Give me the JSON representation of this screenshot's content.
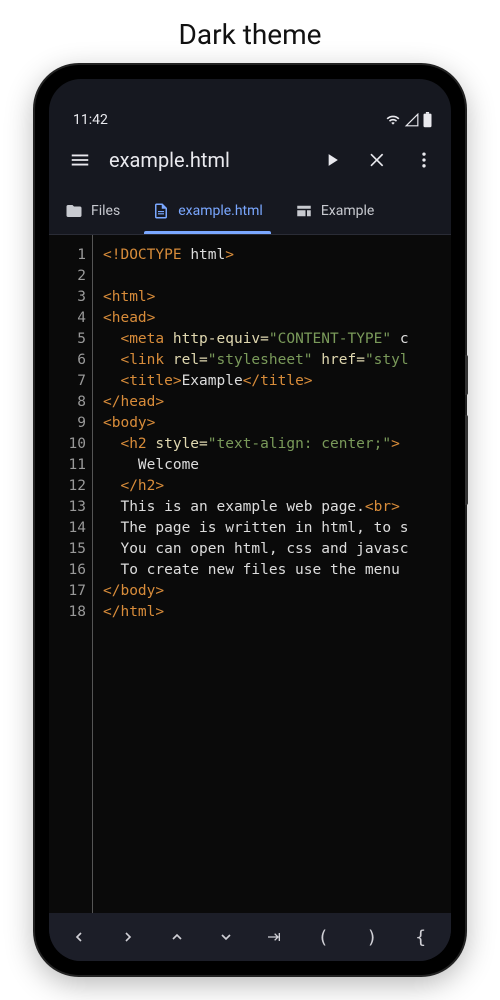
{
  "page_heading": "Dark theme",
  "statusbar": {
    "time": "11:42"
  },
  "appbar": {
    "title": "example.html"
  },
  "tabs": [
    {
      "label": "Files",
      "icon": "folder",
      "active": false
    },
    {
      "label": "example.html",
      "icon": "document",
      "active": true
    },
    {
      "label": "Example",
      "icon": "web",
      "active": false
    }
  ],
  "code_lines": [
    {
      "n": 1,
      "tokens": [
        [
          "decl",
          "<!DOCTYPE "
        ],
        [
          "text",
          "html"
        ],
        [
          "decl",
          ">"
        ]
      ]
    },
    {
      "n": 2,
      "tokens": []
    },
    {
      "n": 3,
      "tokens": [
        [
          "tag",
          "<html>"
        ]
      ]
    },
    {
      "n": 4,
      "tokens": [
        [
          "tag",
          "<head>"
        ]
      ]
    },
    {
      "n": 5,
      "tokens": [
        [
          "text",
          "  "
        ],
        [
          "tag",
          "<meta "
        ],
        [
          "attr",
          "http-equiv="
        ],
        [
          "str",
          "\"CONTENT-TYPE\""
        ],
        [
          "text",
          " c"
        ]
      ]
    },
    {
      "n": 6,
      "tokens": [
        [
          "text",
          "  "
        ],
        [
          "tag",
          "<link "
        ],
        [
          "attr",
          "rel="
        ],
        [
          "str",
          "\"stylesheet\""
        ],
        [
          "text",
          " "
        ],
        [
          "attr",
          "href="
        ],
        [
          "str",
          "\"styl"
        ]
      ]
    },
    {
      "n": 7,
      "tokens": [
        [
          "text",
          "  "
        ],
        [
          "tag",
          "<title>"
        ],
        [
          "text",
          "Example"
        ],
        [
          "tag",
          "</title>"
        ]
      ]
    },
    {
      "n": 8,
      "tokens": [
        [
          "tag",
          "</head>"
        ]
      ]
    },
    {
      "n": 9,
      "tokens": [
        [
          "tag",
          "<body>"
        ]
      ]
    },
    {
      "n": 10,
      "tokens": [
        [
          "text",
          "  "
        ],
        [
          "tag",
          "<h2 "
        ],
        [
          "attr",
          "style="
        ],
        [
          "str",
          "\"text-align: center;\""
        ],
        [
          "tag",
          ">"
        ]
      ]
    },
    {
      "n": 11,
      "tokens": [
        [
          "text",
          "    Welcome"
        ]
      ]
    },
    {
      "n": 12,
      "tokens": [
        [
          "text",
          "  "
        ],
        [
          "tag",
          "</h2>"
        ]
      ]
    },
    {
      "n": 13,
      "tokens": [
        [
          "text",
          "  This is an example web page."
        ],
        [
          "tag",
          "<br>"
        ]
      ]
    },
    {
      "n": 14,
      "tokens": [
        [
          "text",
          "  The page is written in html, to s"
        ]
      ]
    },
    {
      "n": 15,
      "tokens": [
        [
          "text",
          "  You can open html, css and javasc"
        ]
      ]
    },
    {
      "n": 16,
      "tokens": [
        [
          "text",
          "  To create new files use the menu "
        ]
      ]
    },
    {
      "n": 17,
      "tokens": [
        [
          "tag",
          "</body>"
        ]
      ]
    },
    {
      "n": 18,
      "tokens": [
        [
          "tag",
          "</html>"
        ]
      ]
    }
  ],
  "bottom_keys": [
    "‹",
    "›",
    "˄",
    "˅",
    "⇥",
    "(",
    ")",
    "{"
  ]
}
